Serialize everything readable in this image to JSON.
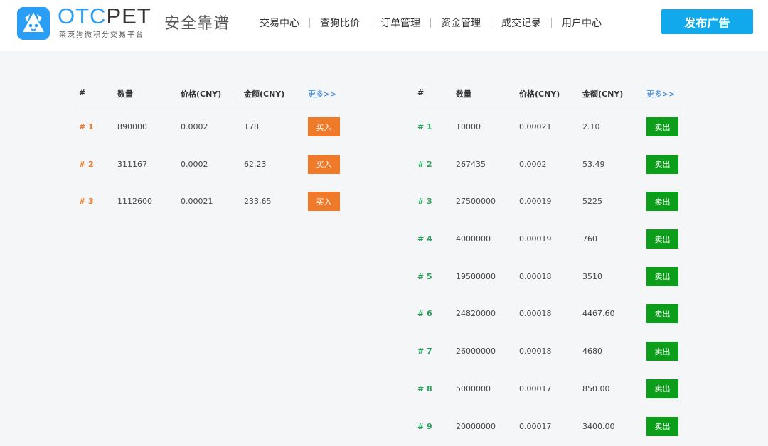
{
  "header": {
    "brand_part1": "OTC",
    "brand_part2": "PET",
    "brand_subtitle": "莱茨狗微积分交易平台",
    "slogan": "安全靠谱",
    "nav": [
      "交易中心",
      "查狗比价",
      "订单管理",
      "资金管理",
      "成交记录",
      "用户中心"
    ],
    "publish_label": "发布广告"
  },
  "colors": {
    "brand_blue": "#2a9df4",
    "publish_button": "#11a9ec",
    "buy_orange": "#ef7b2a",
    "sell_green": "#0c9e1a",
    "more_link": "#2a7ddc"
  },
  "columns": {
    "index": "#",
    "quantity": "数量",
    "price": "价格(CNY)",
    "amount": "金额(CNY)",
    "more": "更多>>"
  },
  "buy_table": {
    "action_label": "买入",
    "rows": [
      {
        "index": "# 1",
        "quantity": "890000",
        "price": "0.0002",
        "amount": "178"
      },
      {
        "index": "# 2",
        "quantity": "311167",
        "price": "0.0002",
        "amount": "62.23"
      },
      {
        "index": "# 3",
        "quantity": "1112600",
        "price": "0.00021",
        "amount": "233.65"
      }
    ]
  },
  "sell_table": {
    "action_label": "卖出",
    "rows": [
      {
        "index": "# 1",
        "quantity": "10000",
        "price": "0.00021",
        "amount": "2.10"
      },
      {
        "index": "# 2",
        "quantity": "267435",
        "price": "0.0002",
        "amount": "53.49"
      },
      {
        "index": "# 3",
        "quantity": "27500000",
        "price": "0.00019",
        "amount": "5225"
      },
      {
        "index": "# 4",
        "quantity": "4000000",
        "price": "0.00019",
        "amount": "760"
      },
      {
        "index": "# 5",
        "quantity": "19500000",
        "price": "0.00018",
        "amount": "3510"
      },
      {
        "index": "# 6",
        "quantity": "24820000",
        "price": "0.00018",
        "amount": "4467.60"
      },
      {
        "index": "# 7",
        "quantity": "26000000",
        "price": "0.00018",
        "amount": "4680"
      },
      {
        "index": "# 8",
        "quantity": "5000000",
        "price": "0.00017",
        "amount": "850.00"
      },
      {
        "index": "# 9",
        "quantity": "20000000",
        "price": "0.00017",
        "amount": "3400.00"
      }
    ]
  }
}
